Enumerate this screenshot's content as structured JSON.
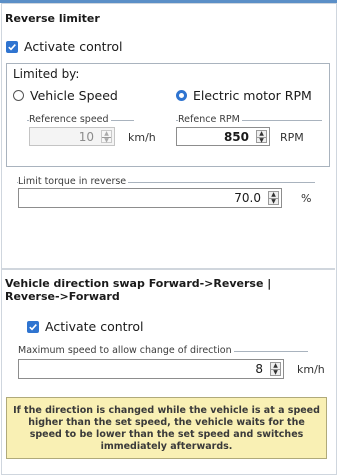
{
  "reverse_limiter": {
    "title": "Reverse limiter",
    "activate_label": "Activate control",
    "activate_checked": true,
    "limited_by_label": "Limited by:",
    "radio_vehicle_speed": "Vehicle Speed",
    "radio_motor_rpm": "Electric motor RPM",
    "selected": "Electric motor RPM",
    "reference_speed_label": "Reference speed",
    "reference_speed_value": "10",
    "reference_speed_unit": "km/h",
    "reference_rpm_label": "Refence RPM",
    "reference_rpm_value": "850",
    "reference_rpm_unit": "RPM",
    "torque_label": "Limit torque in reverse",
    "torque_value": "70.0",
    "torque_unit": "%"
  },
  "direction_swap": {
    "title": "Vehicle direction swap Forward->Reverse | Reverse->Forward",
    "activate_label": "Activate control",
    "activate_checked": true,
    "max_speed_label": "Maximum speed to allow change of direction",
    "max_speed_value": "8",
    "max_speed_unit": "km/h",
    "note": "If the direction is changed while the vehicle is at a speed higher than the set speed, the vehicle waits for the speed to be lower than the set speed and switches immediately afterwards."
  },
  "colors": {
    "accent": "#2f74d0",
    "note_background": "#f9f0b4"
  }
}
